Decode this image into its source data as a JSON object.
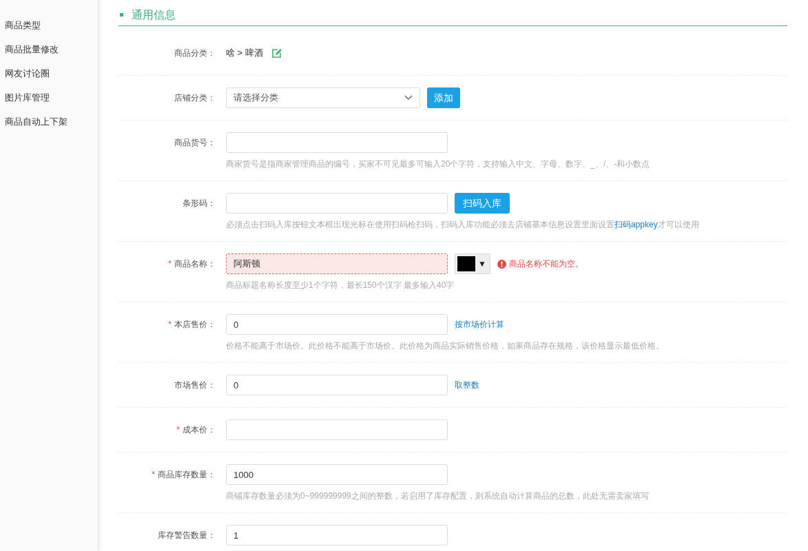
{
  "sidebar": {
    "items": [
      {
        "label": "商品类型",
        "selected": false
      },
      {
        "label": "商品批量修改",
        "selected": false
      },
      {
        "label": "网友讨论圈",
        "selected": false
      },
      {
        "label": "图片库管理",
        "selected": false
      },
      {
        "label": "商品自动上下架",
        "selected": false
      }
    ]
  },
  "section": {
    "title": "通用信息"
  },
  "rows": [
    {
      "kind": "text",
      "label": "商品分类：",
      "value": "啥 > 啤酒"
    },
    {
      "kind": "select",
      "label": "店铺分类：",
      "placeholder": "请选择分类",
      "button": "添加"
    },
    {
      "kind": "input",
      "label": "商品货号：",
      "hint": "商家货号是指商家管理商品的编号，买家不可见最多可输入20个字符，支持输入中文、字母、数字、_、/、-和小数点"
    },
    {
      "kind": "input",
      "label": "条形码：",
      "button": "扫码入库",
      "hint": "必须点击扫码入库按钮文本框出现光标在使用扫码枪扫码，扫码入库功能必须去店铺基本信息设置里面设置",
      "hint_link": "扫码appkey",
      "hint_after": "才可以使用"
    },
    {
      "kind": "input",
      "label": "商品名称：",
      "marker": "*",
      "value": "阿斯顿",
      "invalid": true,
      "color": "#000000",
      "swatch_caret": "▼",
      "error": "商品名称不能为空。",
      "hint": "商品标题名称长度至少1个字符，最长150个汉字 最多输入40字"
    },
    {
      "kind": "input",
      "label": "本店售价：",
      "marker": "*",
      "value": "0",
      "link": "按市场价计算",
      "hint": "价格不能高于市场价。此价格不能高于市场价。此价格为商品实际销售价格，如果商品存在规格，该价格显示最低价格。"
    },
    {
      "kind": "input",
      "label": "市场售价：",
      "value": "0",
      "link": "取整数"
    },
    {
      "kind": "input",
      "label": "成本价：",
      "marker": "*"
    },
    {
      "kind": "input",
      "label": "商品库存数量：",
      "marker": "*",
      "value": "1000",
      "hint": "商铺库存数量必须为0~999999999之间的整数，若启用了库存配置，则系统自动计算商品的总数，此处无需卖家填写"
    },
    {
      "kind": "input",
      "label": "库存警告数量：",
      "value": "1"
    }
  ]
}
